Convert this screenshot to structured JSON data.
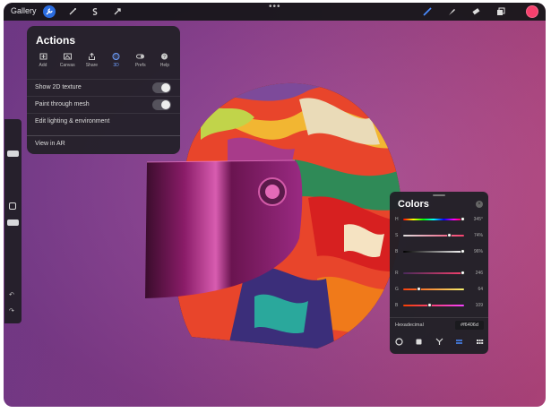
{
  "topbar": {
    "gallery_label": "Gallery",
    "menu_dots": "•••",
    "current_color": "#f6406d"
  },
  "actions": {
    "title": "Actions",
    "tabs": [
      {
        "label": "Add",
        "icon": "add-icon"
      },
      {
        "label": "Canvas",
        "icon": "canvas-icon"
      },
      {
        "label": "Share",
        "icon": "share-icon"
      },
      {
        "label": "3D",
        "icon": "3d-icon",
        "active": true
      },
      {
        "label": "Prefs",
        "icon": "prefs-icon"
      },
      {
        "label": "Help",
        "icon": "help-icon"
      }
    ],
    "rows": [
      {
        "label": "Show 2D texture",
        "toggle": true
      },
      {
        "label": "Paint through mesh",
        "toggle": true
      },
      {
        "label": "Edit lighting & environment",
        "toggle": false
      },
      {
        "label": "View in AR",
        "toggle": false
      }
    ]
  },
  "colors": {
    "title": "Colors",
    "close": "×",
    "sliders": [
      {
        "label": "H",
        "value": "345°",
        "pos": 0.96
      },
      {
        "label": "S",
        "value": "74%",
        "pos": 0.74
      },
      {
        "label": "B",
        "value": "96%",
        "pos": 0.96
      },
      {
        "label": "R",
        "value": "246",
        "pos": 0.96
      },
      {
        "label": "G",
        "value": "64",
        "pos": 0.25
      },
      {
        "label": "B",
        "value": "109",
        "pos": 0.43
      }
    ],
    "hex_label": "Hexadecimal",
    "hex_value": "#f6406d"
  }
}
